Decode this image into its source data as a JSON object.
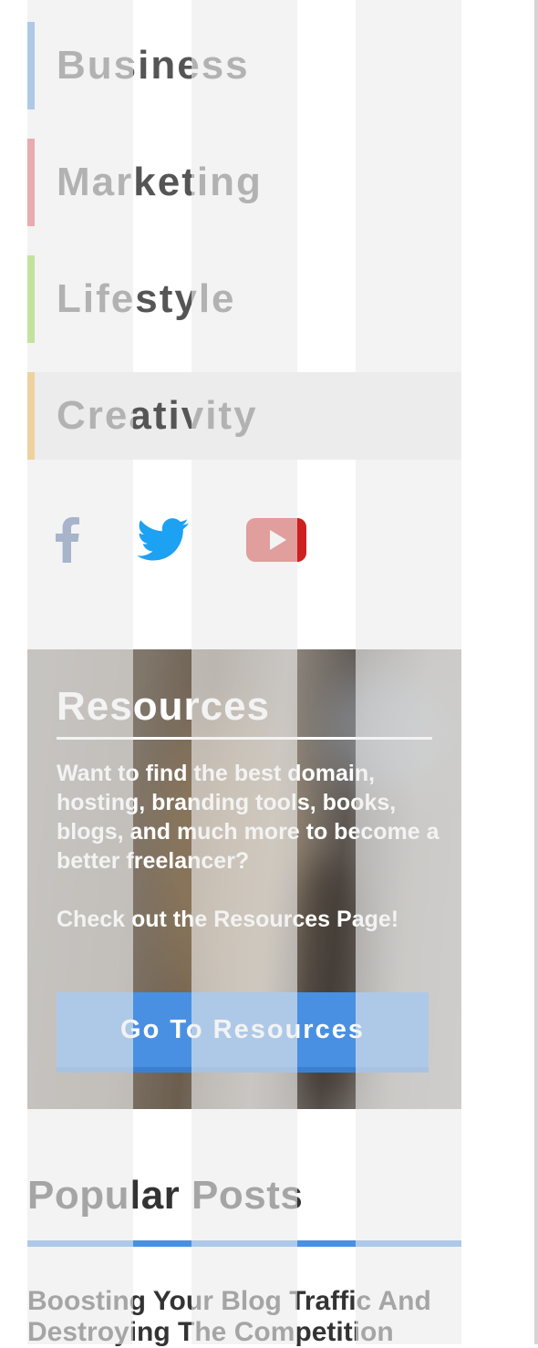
{
  "categories": [
    {
      "label": "Business",
      "color": "#4a90e2"
    },
    {
      "label": "Marketing",
      "color": "#e0424f"
    },
    {
      "label": "Lifestyle",
      "color": "#7ed321"
    },
    {
      "label": "Creativity",
      "color": "#f5a623"
    }
  ],
  "social": {
    "facebook": {
      "icon": "facebook-icon",
      "color": "#3b5998"
    },
    "twitter": {
      "icon": "twitter-icon",
      "color": "#1da1f2"
    },
    "youtube": {
      "icon": "youtube-icon",
      "color": "#cd201f"
    }
  },
  "resources": {
    "title": "Resources",
    "text1": "Want to find the best domain, hosting, branding tools, books, blogs, and much more to become a better freelancer?",
    "text2": "Check out the Resources Page!",
    "button_label": "Go To Resources",
    "button_color": "#4a90e2"
  },
  "popular_posts": {
    "title": "Popular Posts",
    "accent": "#4a90e2",
    "items": [
      {
        "title": "Boosting Your Blog Traffic And Destroying The Competition"
      }
    ]
  }
}
